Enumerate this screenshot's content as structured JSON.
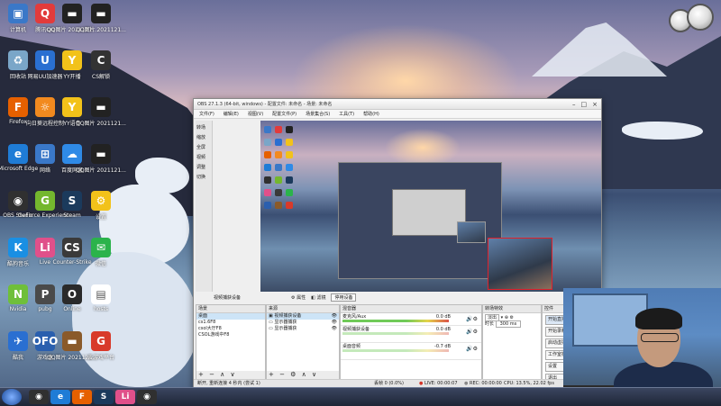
{
  "desktop": {
    "icons": [
      {
        "label": "计算机",
        "color": "#3a78c8",
        "glyph": "▣"
      },
      {
        "label": "腾讯QQ",
        "color": "#e23b3b",
        "glyph": "Q"
      },
      {
        "label": "QQ图片 2021121...",
        "color": "#222222",
        "glyph": "▬"
      },
      {
        "label": "QQ图片 2021121...",
        "color": "#222222",
        "glyph": "▬"
      },
      {
        "label": "回收站",
        "color": "#7aa6c8",
        "glyph": "♻"
      },
      {
        "label": "网易UU加速器",
        "color": "#2a6fd1",
        "glyph": "U"
      },
      {
        "label": "YY开播",
        "color": "#f2c21a",
        "glyph": "Y"
      },
      {
        "label": "CS解锁",
        "color": "#333333",
        "glyph": "C"
      },
      {
        "label": "Firefox",
        "color": "#e66000",
        "glyph": "F"
      },
      {
        "label": "向日葵远程控制",
        "color": "#f28a1f",
        "glyph": "☼"
      },
      {
        "label": "YY语音",
        "color": "#f2c21a",
        "glyph": "Y"
      },
      {
        "label": "QQ图片 2021121...",
        "color": "#222222",
        "glyph": "▬"
      },
      {
        "label": "Microsoft Edge",
        "color": "#1f7cd6",
        "glyph": "e"
      },
      {
        "label": "网络",
        "color": "#3a78c8",
        "glyph": "⊞"
      },
      {
        "label": "百度网盘",
        "color": "#2f8ae6",
        "glyph": "☁"
      },
      {
        "label": "QQ图片 2021121...",
        "color": "#222222",
        "glyph": "▬"
      },
      {
        "label": "OBS Studio",
        "color": "#303030",
        "glyph": "◉"
      },
      {
        "label": "GeForce Experience",
        "color": "#74b72e",
        "glyph": "G"
      },
      {
        "label": "Steam",
        "color": "#1b3a5c",
        "glyph": "S"
      },
      {
        "label": "设置",
        "color": "#f2c21a",
        "glyph": "⚙"
      },
      {
        "label": "酷狗音乐",
        "color": "#1a8fe3",
        "glyph": "K"
      },
      {
        "label": "Live",
        "color": "#e0508a",
        "glyph": "Li"
      },
      {
        "label": "Counter-Strike",
        "color": "#3a3a3a",
        "glyph": "CS"
      },
      {
        "label": "微信",
        "color": "#2bb34b",
        "glyph": "✉"
      },
      {
        "label": "Nvidia",
        "color": "#6fbf3a",
        "glyph": "N"
      },
      {
        "label": "pubg",
        "color": "#4a4a4a",
        "glyph": "P"
      },
      {
        "label": "Online",
        "color": "#2a2a2a",
        "glyph": "O"
      },
      {
        "label": "hosts",
        "color": "#ffffff",
        "glyph": "▤"
      },
      {
        "label": "酷我",
        "color": "#2a6fd1",
        "glyph": "✈"
      },
      {
        "label": "游戏盒",
        "color": "#2a5fae",
        "glyph": "OFO"
      },
      {
        "label": "QQ图片 2021121...",
        "color": "#8a5a2a",
        "glyph": "▬"
      },
      {
        "label": "云游戏平台",
        "color": "#d83a2a",
        "glyph": "G"
      }
    ]
  },
  "taskbar": {
    "items": [
      {
        "glyph": "◉",
        "color": "#303030"
      },
      {
        "glyph": "e",
        "color": "#1f7cd6"
      },
      {
        "glyph": "F",
        "color": "#e66000"
      },
      {
        "glyph": "S",
        "color": "#1b3a5c"
      },
      {
        "glyph": "Li",
        "color": "#e0508a"
      },
      {
        "glyph": "◉",
        "color": "#303030"
      }
    ]
  },
  "obs": {
    "title": "OBS 27.1.3 (64-bit, windows) - 配置文件: 未命名 - 场景: 未命名",
    "menu": [
      "文件(F)",
      "编辑(E)",
      "视图(V)",
      "配置文件(P)",
      "场景集合(S)",
      "工具(T)",
      "帮助(H)"
    ],
    "left_dock": [
      "转场",
      "缩放",
      "全屏",
      "视频",
      "调整",
      "切换"
    ],
    "source_bar": {
      "selected": "视频捕获设备",
      "properties": "属性",
      "filters": "滤镜",
      "deactivate": "停用设备"
    },
    "scenes": {
      "header": "场景",
      "items": [
        "桌面",
        "cs1.6F8",
        "csol大厅F8",
        "CSOL游戏中F8"
      ],
      "footer": "+ − ∧ ∨"
    },
    "sources": {
      "header": "来源",
      "items": [
        "视频捕获设备",
        "显示器捕获",
        "显示器捕获"
      ],
      "footer": "+ − ⚙ ∧ ∨"
    },
    "mixer": {
      "header": "混音器",
      "channels": [
        {
          "name": "麦克风/Aux",
          "db": "0.0 dB"
        },
        {
          "name": "视频捕获设备",
          "db": "0.0 dB"
        },
        {
          "name": "桌面音频",
          "db": "-0.7 dB"
        }
      ]
    },
    "transitions": {
      "header": "转场特效",
      "type": "淡出",
      "duration_label": "时长",
      "duration_value": "300 ms"
    },
    "controls": {
      "header": "控件",
      "buttons": [
        "开始直播",
        "开始录制",
        "启动虚拟摄像机",
        "工作室模式",
        "设置",
        "退出"
      ]
    },
    "status": {
      "left": "断开, 重新连接 4 秒内 (尝试 1)",
      "dropped": "丢帧 0 (0.0%)",
      "live": "LIVE: 00:00:07",
      "rec": "REC: 00:00:00",
      "cpu": "CPU: 13.5%, 22.02 fps"
    }
  }
}
